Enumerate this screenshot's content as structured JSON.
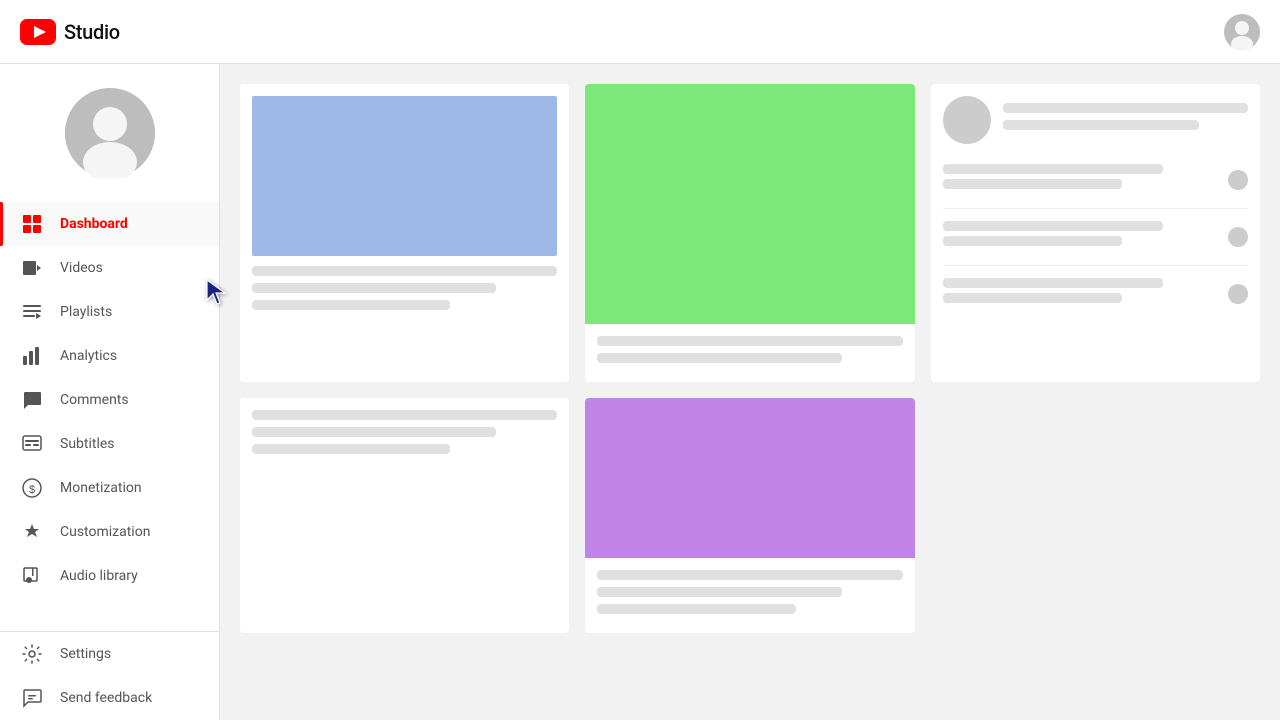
{
  "header": {
    "title": "Studio",
    "logo_alt": "YouTube Studio logo"
  },
  "sidebar": {
    "nav_items": [
      {
        "id": "dashboard",
        "label": "Dashboard",
        "icon": "dashboard-icon",
        "active": true
      },
      {
        "id": "videos",
        "label": "Videos",
        "icon": "videos-icon",
        "active": false
      },
      {
        "id": "playlists",
        "label": "Playlists",
        "icon": "playlists-icon",
        "active": false
      },
      {
        "id": "analytics",
        "label": "Analytics",
        "icon": "analytics-icon",
        "active": false
      },
      {
        "id": "comments",
        "label": "Comments",
        "icon": "comments-icon",
        "active": false
      },
      {
        "id": "subtitles",
        "label": "Subtitles",
        "icon": "subtitles-icon",
        "active": false
      },
      {
        "id": "monetization",
        "label": "Monetization",
        "icon": "monetization-icon",
        "active": false
      },
      {
        "id": "customization",
        "label": "Customization",
        "icon": "customization-icon",
        "active": false
      },
      {
        "id": "audio-library",
        "label": "Audio library",
        "icon": "audio-library-icon",
        "active": false
      }
    ],
    "bottom_items": [
      {
        "id": "settings",
        "label": "Settings",
        "icon": "settings-icon"
      },
      {
        "id": "send-feedback",
        "label": "Send feedback",
        "icon": "feedback-icon"
      }
    ]
  }
}
